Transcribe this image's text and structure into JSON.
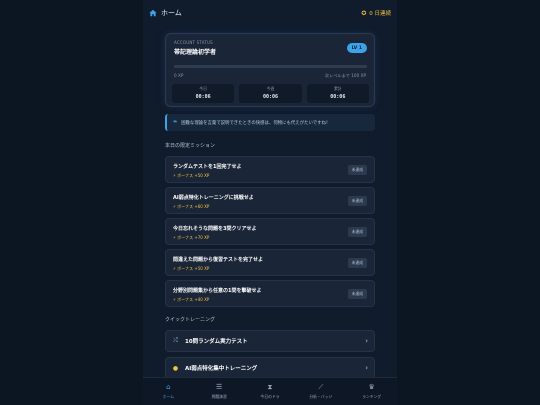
{
  "topbar": {
    "home_label": "ホーム",
    "streak": "0 日連続"
  },
  "status": {
    "label": "ACCOUNT STATUS",
    "rank": "帯記理論初学者",
    "level": "LV 1",
    "xp_current": "0 XP",
    "xp_next": "次レベルまで 100 XP",
    "xp_progress": 0,
    "timers": [
      {
        "label": "今日",
        "value": "00:06"
      },
      {
        "label": "今週",
        "value": "00:06"
      },
      {
        "label": "累計",
        "value": "00:06"
      }
    ]
  },
  "quote": {
    "icon": "quote-icon",
    "text": "困難な理論を言葉で説明できたときの快感は、何物にも代えがたいですね！"
  },
  "missions": {
    "title": "本日の限定ミッション",
    "items": [
      {
        "title": "ランダムテストを1回完了せよ",
        "bonus": "ボーナス +50 XP",
        "status": "未達成"
      },
      {
        "title": "AI弱点特化トレーニングに挑戦せよ",
        "bonus": "ボーナス +60 XP",
        "status": "未達成"
      },
      {
        "title": "今日忘れそうな問題を3問クリアせよ",
        "bonus": "ボーナス +70 XP",
        "status": "未達成"
      },
      {
        "title": "間違えた問題から復習テストを完了せよ",
        "bonus": "ボーナス +50 XP",
        "status": "未達成"
      },
      {
        "title": "分野別問題集から任意の1問を撃破せよ",
        "bonus": "ボーナス +40 XP",
        "status": "未達成"
      }
    ]
  },
  "quick": {
    "title": "クイックトレーニング",
    "items": [
      {
        "label": "10問ランダム実力テスト",
        "icon": "shuffle-icon"
      },
      {
        "label": "AI弱点特化集中トレーニング",
        "icon": "ai-icon"
      }
    ]
  },
  "nav": [
    {
      "label": "ホーム",
      "icon": "home-icon"
    },
    {
      "label": "問題演習",
      "icon": "checklist-icon"
    },
    {
      "label": "今日のドラ",
      "icon": "hourglass-icon"
    },
    {
      "label": "分析・バッジ",
      "icon": "chart-icon"
    },
    {
      "label": "ランキング",
      "icon": "trophy-icon"
    }
  ],
  "colors": {
    "accent": "#3da2e8",
    "bonus": "#f4c542",
    "background": "#0c1522",
    "card": "#1a2638"
  }
}
